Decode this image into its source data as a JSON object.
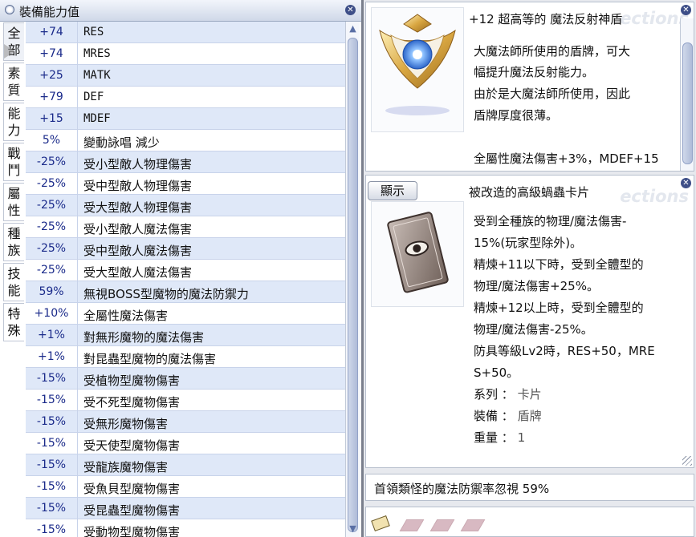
{
  "left_panel": {
    "title": "裝備能力值",
    "tabs": [
      "全部",
      "素質",
      "能力",
      "戰鬥",
      "屬性",
      "種族",
      "技能",
      "特殊"
    ],
    "stats": [
      {
        "value": "+74",
        "label": "RES"
      },
      {
        "value": "+74",
        "label": "MRES"
      },
      {
        "value": "+25",
        "label": "MATK"
      },
      {
        "value": "+79",
        "label": "DEF"
      },
      {
        "value": "+15",
        "label": "MDEF"
      },
      {
        "value": "5%",
        "label": "變動詠唱 減少"
      },
      {
        "value": "-25%",
        "label": "受小型敵人物理傷害"
      },
      {
        "value": "-25%",
        "label": "受中型敵人物理傷害"
      },
      {
        "value": "-25%",
        "label": "受大型敵人物理傷害"
      },
      {
        "value": "-25%",
        "label": "受小型敵人魔法傷害"
      },
      {
        "value": "-25%",
        "label": "受中型敵人魔法傷害"
      },
      {
        "value": "-25%",
        "label": "受大型敵人魔法傷害"
      },
      {
        "value": "59%",
        "label": "無視BOSS型魔物的魔法防禦力"
      },
      {
        "value": "+10%",
        "label": "全屬性魔法傷害"
      },
      {
        "value": "+1%",
        "label": "對無形魔物的魔法傷害"
      },
      {
        "value": "+1%",
        "label": "對昆蟲型魔物的魔法傷害"
      },
      {
        "value": "-15%",
        "label": "受植物型魔物傷害"
      },
      {
        "value": "-15%",
        "label": "受不死型魔物傷害"
      },
      {
        "value": "-15%",
        "label": "受無形魔物傷害"
      },
      {
        "value": "-15%",
        "label": "受天使型魔物傷害"
      },
      {
        "value": "-15%",
        "label": "受龍族魔物傷害"
      },
      {
        "value": "-15%",
        "label": "受魚貝型魔物傷害"
      },
      {
        "value": "-15%",
        "label": "受昆蟲型魔物傷害"
      },
      {
        "value": "-15%",
        "label": "受動物型魔物傷害"
      }
    ]
  },
  "item_panel": {
    "name": "+12 超高等的 魔法反射神盾",
    "watermark": "ections",
    "description": [
      "大魔法師所使用的盾牌，可大",
      "幅提升魔法反射能力。",
      "由於是大魔法師所使用，因此",
      "盾牌厚度很薄。",
      "",
      "全屬性魔法傷害+3%，MDEF+15"
    ]
  },
  "card_panel": {
    "show_button": "顯示",
    "name": "被改造的高級蝸蟲卡片",
    "watermark": "ections",
    "description": [
      "受到全種族的物理/魔法傷害-",
      "15%(玩家型除外)。",
      "精煉+11以下時，受到全體型的",
      "物理/魔法傷害+25%。",
      "精煉+12以上時，受到全體型的",
      "物理/魔法傷害-25%。",
      "防具等級Lv2時，RES+50，MRE",
      "S+50。"
    ],
    "properties": [
      {
        "key": "系列",
        "value": "卡片"
      },
      {
        "key": "裝備",
        "value": "盾牌"
      },
      {
        "key": "重量",
        "value": "1"
      }
    ]
  },
  "option_bar": {
    "text": "首領類怪的魔法防禦率忽視 59%"
  },
  "close_symbol": "✕",
  "colors": {
    "row_alt": "#dfe8f8",
    "title_bar": "#cfd8e8",
    "value_text": "#1a2a8a"
  }
}
